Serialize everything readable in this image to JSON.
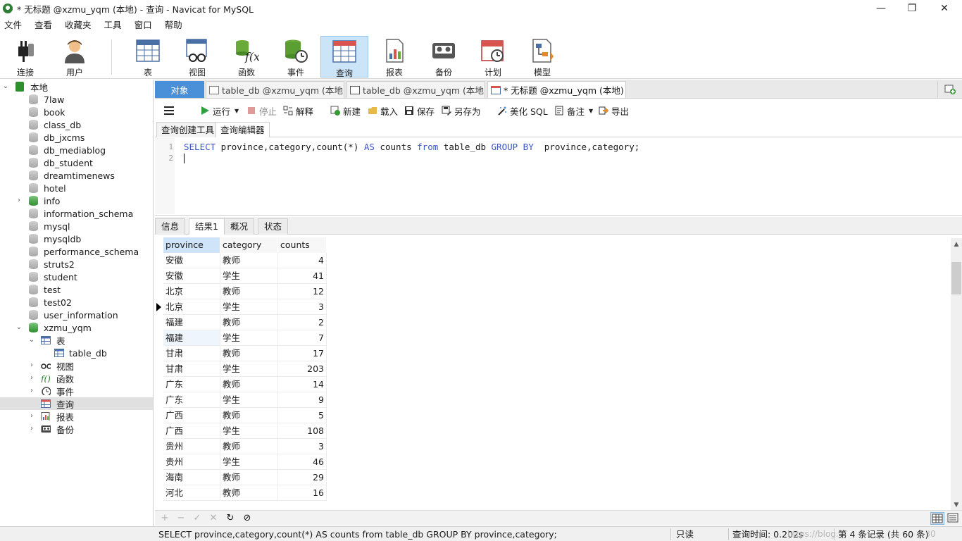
{
  "window": {
    "title": "* 无标题 @xzmu_yqm (本地) - 查询 - Navicat for MySQL",
    "minimize": "—",
    "restore": "❐",
    "close": "✕"
  },
  "menu": [
    "文件",
    "查看",
    "收藏夹",
    "工具",
    "窗口",
    "帮助"
  ],
  "toolbar": {
    "connect": "连接",
    "user": "用户",
    "table": "表",
    "view": "视图",
    "function": "函数",
    "event": "事件",
    "query": "查询",
    "report": "报表",
    "backup": "备份",
    "schedule": "计划",
    "model": "模型"
  },
  "tree": {
    "root": "本地",
    "dbs": [
      "7law",
      "book",
      "class_db",
      "db_jxcms",
      "db_mediablog",
      "db_student",
      "dreamtimenews",
      "hotel",
      "info",
      "information_schema",
      "mysql",
      "mysqldb",
      "performance_schema",
      "struts2",
      "student",
      "test",
      "test02",
      "user_information",
      "xzmu_yqm"
    ],
    "tables_node": "表",
    "table_item": "table_db",
    "views_node": "视图",
    "functions_node": "函数",
    "events_node": "事件",
    "queries_node": "查询",
    "reports_node": "报表",
    "backups_node": "备份"
  },
  "tabs": {
    "objects": "对象",
    "tab1": "table_db @xzmu_yqm (本地)...",
    "tab2": "table_db @xzmu_yqm (本地)...",
    "tab3": "* 无标题 @xzmu_yqm (本地) ..."
  },
  "editor_toolbar": {
    "run": "运行",
    "stop": "停止",
    "explain": "解释",
    "new": "新建",
    "load": "载入",
    "save": "保存",
    "save_as": "另存为",
    "beautify": "美化 SQL",
    "comment": "备注",
    "export": "导出"
  },
  "subtabs": {
    "builder": "查询创建工具",
    "editor": "查询编辑器"
  },
  "editor": {
    "line1": "1",
    "line2": "2",
    "kw_select": "SELECT",
    "part1": " province,category,count(*) ",
    "kw_as": "AS",
    "part2": " counts ",
    "kw_from": "from",
    "part3": " table_db ",
    "kw_group": "GROUP BY",
    "part4": "  province,category;"
  },
  "result_tabs": {
    "info": "信息",
    "result1": "结果1",
    "overview": "概况",
    "status": "状态"
  },
  "grid": {
    "columns": [
      "province",
      "category",
      "counts"
    ],
    "rows": [
      [
        "安徽",
        "教师",
        "4"
      ],
      [
        "安徽",
        "学生",
        "41"
      ],
      [
        "北京",
        "教师",
        "12"
      ],
      [
        "北京",
        "学生",
        "3"
      ],
      [
        "福建",
        "教师",
        "2"
      ],
      [
        "福建",
        "学生",
        "7"
      ],
      [
        "甘肃",
        "教师",
        "17"
      ],
      [
        "甘肃",
        "学生",
        "203"
      ],
      [
        "广东",
        "教师",
        "14"
      ],
      [
        "广东",
        "学生",
        "9"
      ],
      [
        "广西",
        "教师",
        "5"
      ],
      [
        "广西",
        "学生",
        "108"
      ],
      [
        "贵州",
        "教师",
        "3"
      ],
      [
        "贵州",
        "学生",
        "46"
      ],
      [
        "海南",
        "教师",
        "29"
      ],
      [
        "河北",
        "教师",
        "16"
      ]
    ]
  },
  "gridbar": {
    "add": "+",
    "remove": "−",
    "apply": "✓",
    "discard": "✕",
    "refresh": "↻",
    "stop": "⊘"
  },
  "status": {
    "sql": "SELECT province,category,count(*) AS counts from table_db GROUP BY  province,category;",
    "readonly": "只读",
    "query_time": "查询时间: 0.202s",
    "records": "第 4 条记录 (共 60 条)",
    "watermark": "https://blog.csdn.net/qq_40303930"
  },
  "colors": {
    "accent": "#4a90d9",
    "keyword": "#3a55c8",
    "selected_tool": "#cce4f7"
  }
}
